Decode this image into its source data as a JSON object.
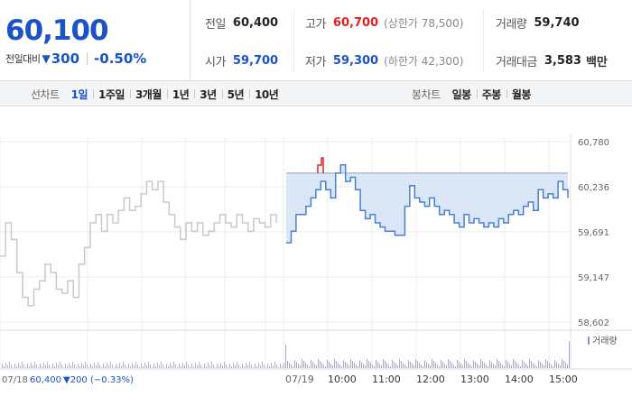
{
  "quote": {
    "price": "60,100",
    "change_label": "전일대비",
    "change_arrow": "▼",
    "change_value": "300",
    "change_rate": "-0.50%",
    "prev_close": {
      "label": "전일",
      "value": "60,400"
    },
    "open": {
      "label": "시가",
      "value": "59,700"
    },
    "high": {
      "label": "고가",
      "value": "60,700",
      "upper_limit": "(상한가 78,500)"
    },
    "low": {
      "label": "저가",
      "value": "59,300",
      "lower_limit": "(하한가 42,300)"
    },
    "volume": {
      "label": "거래량",
      "value": "59,740"
    },
    "amount": {
      "label": "거래대금",
      "value": "3,583",
      "unit": "백만"
    }
  },
  "toolbar": {
    "line_chart": {
      "title": "선차트",
      "items": [
        "1일",
        "1주일",
        "3개월",
        "1년",
        "3년",
        "5년",
        "10년"
      ],
      "active": "1일"
    },
    "candle_chart": {
      "title": "봉차트",
      "items": [
        "일봉",
        "주봉",
        "월봉"
      ]
    }
  },
  "chart_data": {
    "type": "line",
    "y_ticks": [
      "60,780",
      "60,236",
      "59,691",
      "59,147",
      "58,602"
    ],
    "ylim": [
      58602,
      60780
    ],
    "x_ticks": [
      "07/19",
      "10:00",
      "11:00",
      "12:00",
      "13:00",
      "14:00",
      "15:00"
    ],
    "prev_session": {
      "date": "07/18",
      "close": "60,400",
      "change_arrow": "▼",
      "change": "200",
      "rate": "(−0.33%)"
    },
    "volume_label": "거래량",
    "colors": {
      "today": "#4a7fd4",
      "prev": "#c9c9c9",
      "fill": "#dbe6f6",
      "up": "#e02222",
      "volume": "#b5b5c8"
    },
    "prev_series": [
      59400,
      59800,
      59600,
      59200,
      58900,
      58800,
      59000,
      59100,
      59300,
      59200,
      59000,
      58950,
      59100,
      58900,
      59300,
      59500,
      59800,
      59900,
      59700,
      59900,
      59800,
      59950,
      60100,
      59950,
      60000,
      60150,
      60300,
      60200,
      60300,
      60050,
      59900,
      59750,
      59600,
      59800,
      59700,
      59800,
      59650,
      59700,
      59800,
      59900,
      59800,
      59750,
      59900,
      59800,
      59700,
      59850,
      59800,
      59750,
      59900,
      59800
    ],
    "today_series": [
      59560,
      59700,
      59900,
      59900,
      60000,
      60100,
      60200,
      60300,
      60200,
      60100,
      60400,
      60500,
      60300,
      60350,
      60200,
      59950,
      59850,
      59900,
      59800,
      59750,
      59700,
      59700,
      59650,
      59650,
      60000,
      60250,
      60100,
      60050,
      60000,
      60100,
      60000,
      59900,
      59950,
      59900,
      59800,
      59750,
      59900,
      59800,
      59850,
      59800,
      59750,
      59800,
      59750,
      59850,
      59800,
      59900,
      59950,
      59900,
      60000,
      60050,
      59950,
      60200,
      60100,
      60150,
      60100,
      60300,
      60200,
      60100
    ]
  }
}
